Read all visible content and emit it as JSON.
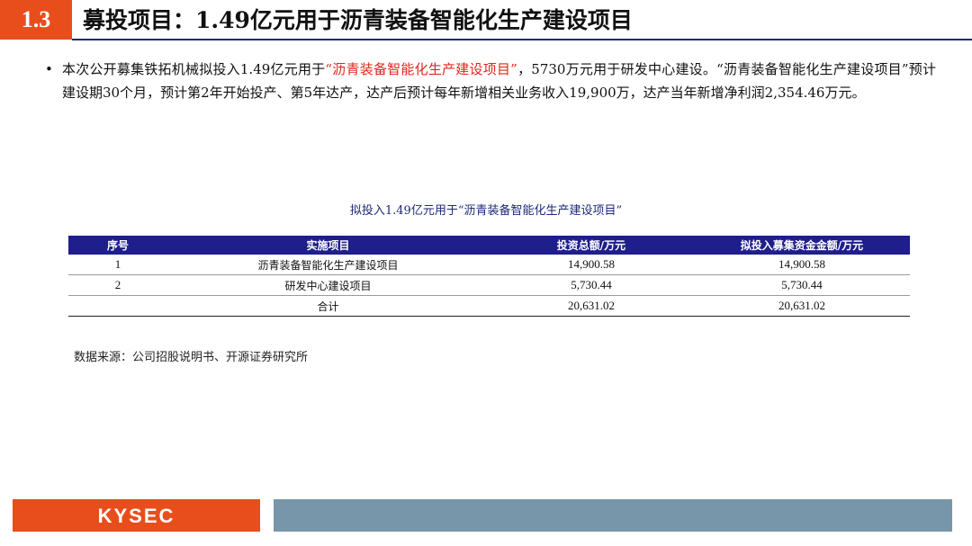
{
  "header": {
    "section_number": "1.3",
    "title": "募投项目：1.49亿元用于沥青装备智能化生产建设项目"
  },
  "bullet": {
    "part1": "本次公开募集铁拓机械拟投入1.49亿元用于",
    "highlight": "“沥青装备智能化生产建设项目”",
    "part2": "，5730万元用于研发中心建设。“沥青装备智能化生产建设项目”预计建设期30个月，预计第2年开始投产、第5年达产，达产后预计每年新增相关业务收入19,900万，达产当年新增净利润2,354.46万元。"
  },
  "table": {
    "caption": "拟投入1.49亿元用于“沥青装备智能化生产建设项目”",
    "headers": [
      "序号",
      "实施项目",
      "投资总额/万元",
      "拟投入募集资金金额/万元"
    ],
    "rows": [
      [
        "1",
        "沥青装备智能化生产建设项目",
        "14,900.58",
        "14,900.58"
      ],
      [
        "2",
        "研发中心建设项目",
        "5,730.44",
        "5,730.44"
      ],
      [
        "",
        "合计",
        "20,631.02",
        "20,631.02"
      ]
    ]
  },
  "source": "数据来源：公司招股说明书、开源证券研究所",
  "footer": {
    "logo_text": "KYSEC"
  },
  "colors": {
    "accent_orange": "#e84e1b",
    "navy": "#1e1e8c",
    "highlight_red": "#e0261b",
    "footer_blue_gray": "#7896aa"
  }
}
